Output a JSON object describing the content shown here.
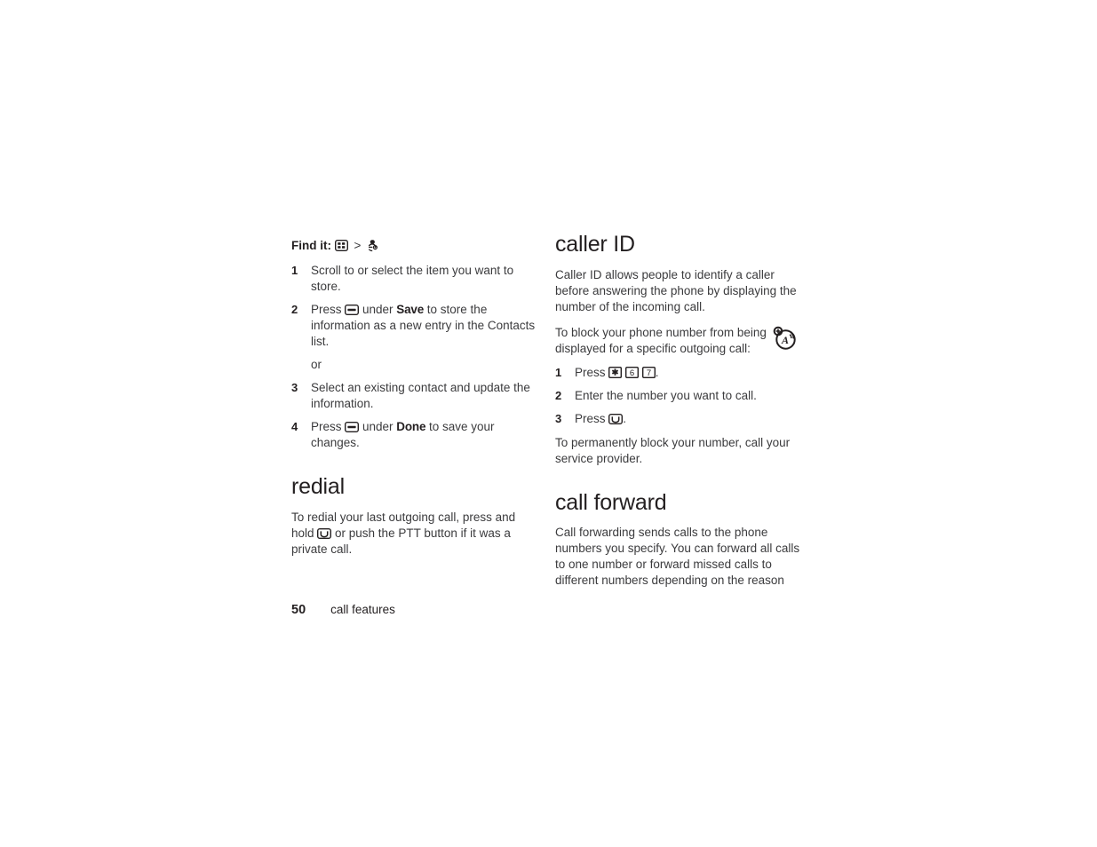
{
  "page": {
    "number": "50",
    "section": "call features"
  },
  "left_column": {
    "find_it": {
      "label": "Find it:",
      "separator": ">",
      "icons": [
        "main-menu-icon",
        "contacts-icon"
      ]
    },
    "steps": [
      {
        "num": "1",
        "parts": [
          {
            "type": "text",
            "value": "Scroll to or select the item you want to store."
          }
        ]
      },
      {
        "num": "2",
        "parts": [
          {
            "type": "text",
            "value": "Press "
          },
          {
            "type": "icon",
            "value": "soft-key-icon"
          },
          {
            "type": "text",
            "value": " under "
          },
          {
            "type": "softkey",
            "value": "Save"
          },
          {
            "type": "text",
            "value": " to store the information as a new entry in the Contacts list."
          }
        ]
      }
    ],
    "or_text": "or",
    "steps_after_or": [
      {
        "num": "3",
        "parts": [
          {
            "type": "text",
            "value": "Select an existing contact and update the information."
          }
        ]
      },
      {
        "num": "4",
        "parts": [
          {
            "type": "text",
            "value": "Press "
          },
          {
            "type": "icon",
            "value": "soft-key-icon"
          },
          {
            "type": "text",
            "value": " under "
          },
          {
            "type": "softkey",
            "value": "Done"
          },
          {
            "type": "text",
            "value": " to save your changes."
          }
        ]
      }
    ],
    "redial": {
      "heading": "redial",
      "body_before": "To redial your last outgoing call, press and hold ",
      "icon": "send-key-icon",
      "body_after": " or push the PTT button if it was a private call."
    }
  },
  "right_column": {
    "caller_id": {
      "heading": "caller ID",
      "paragraph_1": "Caller ID allows people to identify a caller before answering the phone by displaying the number of the incoming call.",
      "paragraph_2": "To block your phone number from being displayed for a specific outgoing call:",
      "steps": [
        {
          "num": "1",
          "parts": [
            {
              "type": "text",
              "value": "Press "
            },
            {
              "type": "keycap",
              "value": "✱"
            },
            {
              "type": "text",
              "value": " "
            },
            {
              "type": "keycap",
              "value": "6"
            },
            {
              "type": "text",
              "value": " "
            },
            {
              "type": "keycap",
              "value": "7"
            },
            {
              "type": "text",
              "value": "."
            }
          ]
        },
        {
          "num": "2",
          "parts": [
            {
              "type": "text",
              "value": "Enter the number you want to call."
            }
          ]
        },
        {
          "num": "3",
          "parts": [
            {
              "type": "text",
              "value": "Press "
            },
            {
              "type": "icon",
              "value": "send-key-icon"
            },
            {
              "type": "text",
              "value": "."
            }
          ]
        }
      ],
      "paragraph_3": "To permanently block your number, call your service provider."
    },
    "call_forward": {
      "heading": "call forward",
      "paragraph_1": "Call forwarding sends calls to the phone numbers you specify. You can forward all calls to one number or forward missed calls to different numbers depending on the reason"
    },
    "margin_note_icon": "note-tip-icon"
  },
  "colors": {
    "text": "#231f20",
    "body_text": "#3b3b3d",
    "background": "#ffffff"
  }
}
